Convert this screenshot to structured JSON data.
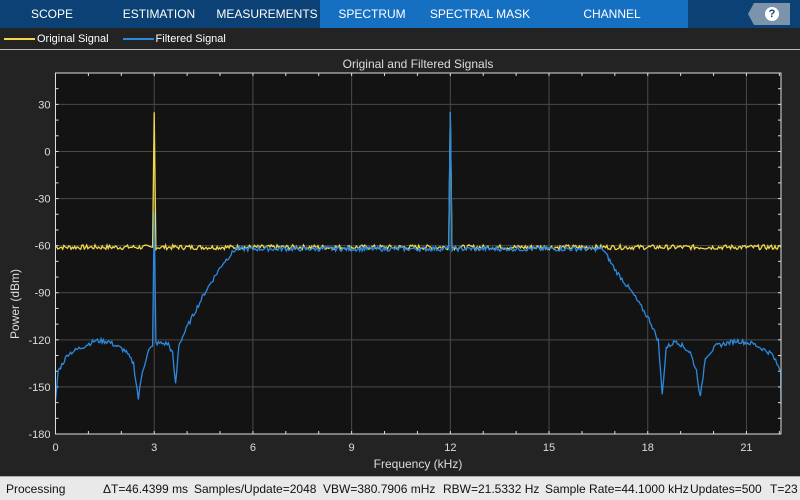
{
  "toolbar": {
    "tabs": [
      "SCOPE",
      "ESTIMATION",
      "MEASUREMENTS",
      "SPECTRUM",
      "SPECTRAL MASK",
      "CHANNEL MEASUREMENTS"
    ],
    "selected_tab": "SPECTRUM",
    "help_label": "?"
  },
  "legend": {
    "items": [
      {
        "label": "Original Signal",
        "color": "#f2d84a"
      },
      {
        "label": "Filtered Signal",
        "color": "#2a8ae0"
      }
    ]
  },
  "status": {
    "state": "Processing",
    "delta_t": "ΔT=46.4399 ms",
    "samples": "Samples/Update=2048",
    "vbw": "VBW=380.7906 mHz",
    "rbw": "RBW=21.5332 Hz",
    "sample_rate": "Sample Rate=44.1000 kHz",
    "updates": "Updates=500",
    "time": "T=23"
  },
  "chart_data": {
    "type": "line",
    "title": "Original and Filtered Signals",
    "xlabel": "Frequency (kHz)",
    "ylabel": "Power (dBm)",
    "xlim": [
      0,
      22.05
    ],
    "ylim": [
      -180,
      50
    ],
    "xticks": [
      0,
      3,
      6,
      9,
      12,
      15,
      18,
      21
    ],
    "yticks": [
      30,
      0,
      -30,
      -60,
      -90,
      -120,
      -150,
      -180
    ],
    "grid": true,
    "legend_position": "top-left",
    "series": [
      {
        "name": "Original Signal",
        "color": "#f2d84a",
        "x": [
          0,
          2.95,
          3.0,
          3.05,
          11.95,
          12.0,
          12.05,
          22.05
        ],
        "y": [
          -61,
          -61,
          25,
          -61,
          -61,
          25,
          -61,
          -61
        ]
      },
      {
        "name": "Filtered Signal",
        "color": "#2a8ae0",
        "x": [
          0,
          0.08,
          0.38,
          1.2,
          1.6,
          2.12,
          2.37,
          2.52,
          2.64,
          2.83,
          2.95,
          3.0,
          3.05,
          3.43,
          3.56,
          3.65,
          3.75,
          4.05,
          4.57,
          5.08,
          5.48,
          11.95,
          12.0,
          12.05,
          16.63,
          17.03,
          17.55,
          18.07,
          18.32,
          18.44,
          18.56,
          18.87,
          19.29,
          19.48,
          19.6,
          19.75,
          20.09,
          20.7,
          21.22,
          21.77,
          22.04,
          22.05
        ],
        "y": [
          -160,
          -140,
          -129,
          -120.6,
          -121,
          -127,
          -135,
          -157.6,
          -140,
          -127,
          -124,
          -38,
          -122,
          -122.6,
          -129,
          -148.7,
          -123,
          -109.7,
          -88.7,
          -71.5,
          -62,
          -62,
          25,
          -62,
          -62,
          -76,
          -90.6,
          -108,
          -120.6,
          -155,
          -125,
          -120.6,
          -128,
          -139.7,
          -157,
          -131,
          -123.8,
          -120.6,
          -122.6,
          -129,
          -140,
          -161
        ]
      }
    ]
  }
}
